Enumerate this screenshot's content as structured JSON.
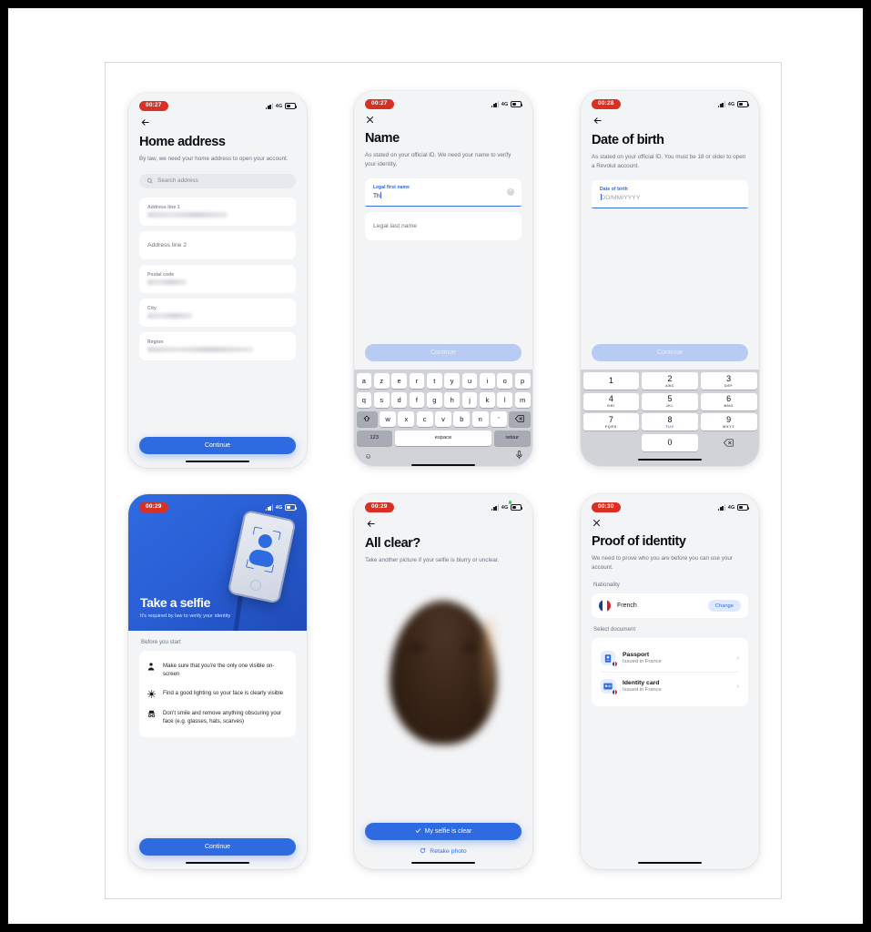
{
  "screens": [
    {
      "id": "home-address",
      "status": {
        "time": "00:27",
        "network": "4G"
      },
      "nav_icon": "back-arrow-icon",
      "title": "Home address",
      "subtitle": "By law, we need your home address to open your account.",
      "search": {
        "placeholder": "Search address",
        "icon": "search-icon"
      },
      "fields": [
        {
          "label": "Address line 1",
          "value": "",
          "redacted": true,
          "placeholder": ""
        },
        {
          "label": "",
          "value": "",
          "redacted": false,
          "placeholder": "Address line 2"
        },
        {
          "label": "Postal code",
          "value": "",
          "redacted": true,
          "placeholder": ""
        },
        {
          "label": "City",
          "value": "",
          "redacted": true,
          "placeholder": ""
        },
        {
          "label": "Region",
          "value": "",
          "redacted": true,
          "placeholder": ""
        }
      ],
      "cta": {
        "label": "Continue",
        "enabled": true
      }
    },
    {
      "id": "name",
      "status": {
        "time": "00:27",
        "network": "4G"
      },
      "nav_icon": "close-x-icon",
      "title": "Name",
      "subtitle": "As stated on your official ID. We need your name to verify your identity.",
      "first_name": {
        "label": "Legal first name",
        "value": "Th",
        "clear_icon": "clear-circle-icon"
      },
      "last_name": {
        "placeholder": "Legal last name",
        "value": ""
      },
      "cta": {
        "label": "Continue",
        "enabled": false
      },
      "keyboard": {
        "type": "azerty",
        "row1": [
          "a",
          "z",
          "e",
          "r",
          "t",
          "y",
          "u",
          "i",
          "o",
          "p"
        ],
        "row2": [
          "q",
          "s",
          "d",
          "f",
          "g",
          "h",
          "j",
          "k",
          "l",
          "m"
        ],
        "row3": [
          "w",
          "x",
          "c",
          "v",
          "b",
          "n",
          "’"
        ],
        "shift_icon": "shift-icon",
        "backspace_icon": "backspace-icon",
        "numeric_key": "123",
        "space_key": "espace",
        "return_key": "retour",
        "emoji_icon": "emoji-icon",
        "mic_icon": "microphone-icon"
      }
    },
    {
      "id": "date-of-birth",
      "status": {
        "time": "00:28",
        "network": "4G"
      },
      "nav_icon": "back-arrow-icon",
      "title": "Date of birth",
      "subtitle": "As stated on your official ID. You must be 18 or older to open a Revolut account.",
      "dob": {
        "label": "Date of birth",
        "placeholder": "DD/MM/YYYY",
        "value": ""
      },
      "cta": {
        "label": "Continue",
        "enabled": false
      },
      "numpad": {
        "keys": [
          {
            "digit": "1",
            "letters": ""
          },
          {
            "digit": "2",
            "letters": "ABC"
          },
          {
            "digit": "3",
            "letters": "DEF"
          },
          {
            "digit": "4",
            "letters": "GHI"
          },
          {
            "digit": "5",
            "letters": "JKL"
          },
          {
            "digit": "6",
            "letters": "MNO"
          },
          {
            "digit": "7",
            "letters": "PQRS"
          },
          {
            "digit": "8",
            "letters": "TUV"
          },
          {
            "digit": "9",
            "letters": "WXYZ"
          },
          {
            "digit": "0",
            "letters": ""
          }
        ],
        "backspace_icon": "backspace-icon"
      }
    },
    {
      "id": "take-a-selfie",
      "status": {
        "time": "00:29",
        "network": "4G"
      },
      "hero": {
        "title": "Take a selfie",
        "subtitle": "It's required by law to verify your identity",
        "art_icon": "selfie-stick-phone-illustration"
      },
      "section_label": "Before you start",
      "tips": [
        {
          "icon": "person-icon",
          "text": "Make sure that you're the only one visible on-screen"
        },
        {
          "icon": "lightbulb-icon",
          "text": "Find a good lighting so your face is clearly visible"
        },
        {
          "icon": "no-hat-glasses-icon",
          "text": "Don't smile and remove anything obscuring your face (e.g. glasses, hats, scarves)"
        }
      ],
      "cta": {
        "label": "Continue",
        "enabled": true
      }
    },
    {
      "id": "all-clear",
      "status": {
        "time": "00:29",
        "network": "4G",
        "camera_active": true
      },
      "nav_icon": "back-arrow-icon",
      "title": "All clear?",
      "subtitle": "Take another picture if your selfie is blurry or unclear.",
      "preview": {
        "alt": "blurred-selfie-photo"
      },
      "cta": {
        "label": "My selfie is clear",
        "icon": "check-icon",
        "enabled": true
      },
      "secondary": {
        "label": "Retake photo",
        "icon": "refresh-icon"
      }
    },
    {
      "id": "proof-of-identity",
      "status": {
        "time": "00:30",
        "network": "4G"
      },
      "nav_icon": "close-x-icon",
      "title": "Proof of identity",
      "subtitle": "We need to prove who you are before you can use your account.",
      "nationality_label": "Nationality",
      "nationality": {
        "name": "French",
        "flag": "france-flag-icon",
        "change_label": "Change"
      },
      "select_document_label": "Select document",
      "documents": [
        {
          "title": "Passport",
          "subtitle": "Issued in France",
          "icon": "passport-icon"
        },
        {
          "title": "Identity card",
          "subtitle": "Issued in France",
          "icon": "id-card-icon"
        }
      ]
    }
  ],
  "colors": {
    "accent": "#2f6be0",
    "accent_disabled": "#b8cbf2",
    "clock_pill": "#d93025",
    "screen_bg": "#f3f4f6",
    "card": "#ffffff",
    "keyboard_bg": "#d1d3d9",
    "camera_dot": "#30d158",
    "flag_blue": "#1b3d8f",
    "flag_red": "#d0212c"
  }
}
